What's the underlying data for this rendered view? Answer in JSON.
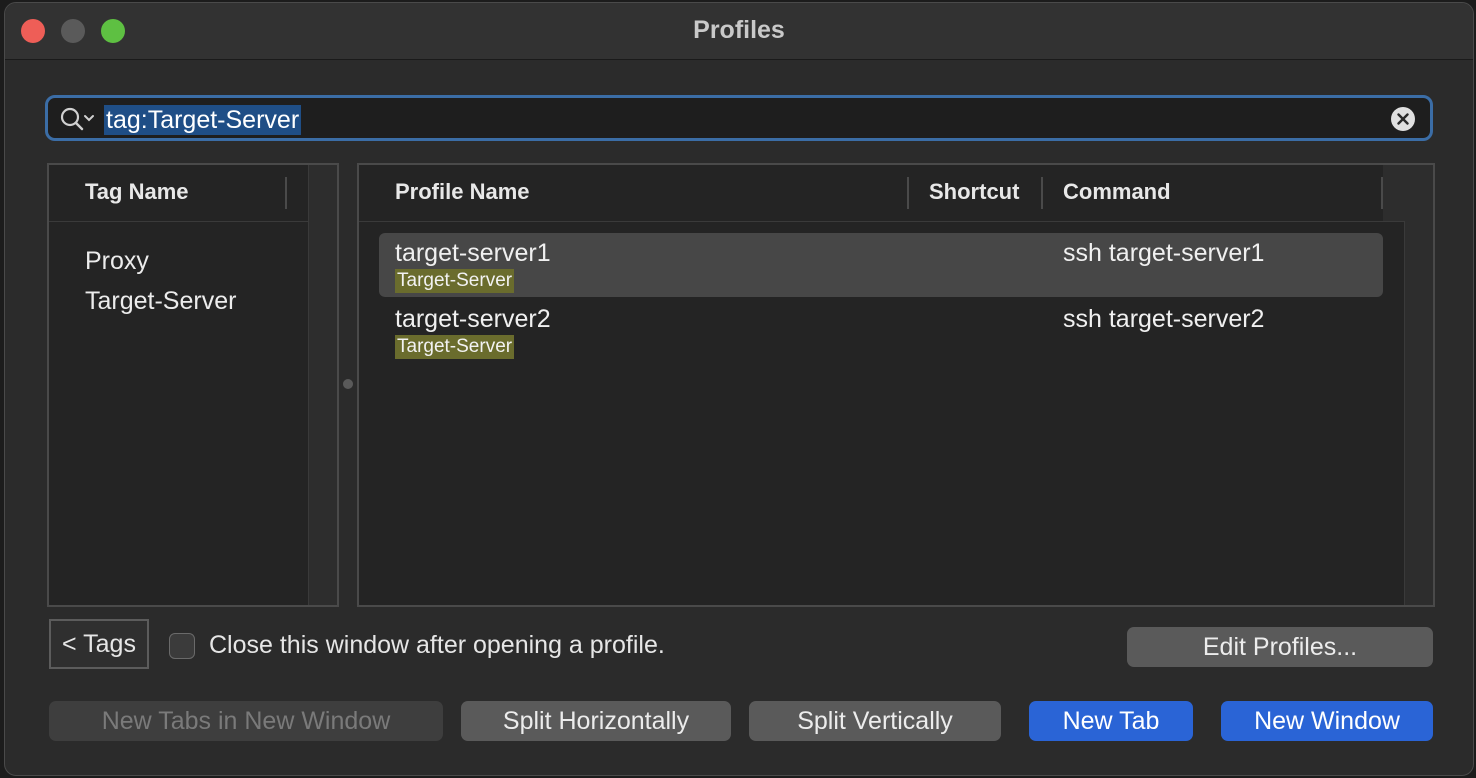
{
  "window": {
    "title": "Profiles"
  },
  "search": {
    "value": "tag:Target-Server"
  },
  "tags_panel": {
    "header": "Tag Name",
    "items": [
      "Proxy",
      "Target-Server"
    ]
  },
  "profiles_panel": {
    "headers": {
      "name": "Profile Name",
      "shortcut": "Shortcut",
      "command": "Command"
    },
    "rows": [
      {
        "name": "target-server1",
        "tag": "Target-Server",
        "shortcut": "",
        "command": "ssh target-server1",
        "selected": true
      },
      {
        "name": "target-server2",
        "tag": "Target-Server",
        "shortcut": "",
        "command": "ssh target-server2",
        "selected": false
      }
    ]
  },
  "footer": {
    "tags_button": "< Tags",
    "close_checkbox_label": "Close this window after opening a profile.",
    "close_checkbox_checked": false,
    "edit_profiles": "Edit Profiles...",
    "new_tabs_in_new_window": "New Tabs in New Window",
    "split_horizontally": "Split Horizontally",
    "split_vertically": "Split Vertically",
    "new_tab": "New Tab",
    "new_window": "New Window"
  },
  "colors": {
    "accent": "#2a64d6",
    "search_focus": "#3b6da6",
    "tag_highlight": "#6a6c2d",
    "close": "#ee5e57",
    "maximize": "#5ec042"
  }
}
